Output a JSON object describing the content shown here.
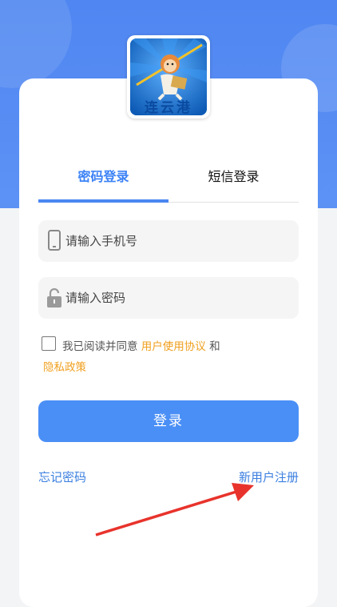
{
  "logo": {
    "text": "连云港"
  },
  "tabs": {
    "password_login": "密码登录",
    "sms_login": "短信登录",
    "active": "password_login"
  },
  "phone": {
    "placeholder": "请输入手机号",
    "value": ""
  },
  "password": {
    "placeholder": "请输入密码",
    "value": ""
  },
  "agreement": {
    "prefix": "我已阅读并同意 ",
    "user_agreement": "用户使用协议",
    "and": " 和",
    "privacy_policy": "隐私政策",
    "checked": false
  },
  "login_button": "登录",
  "forgot_password": "忘记密码",
  "register": "新用户注册",
  "colors": {
    "primary": "#4a8ff6",
    "link": "#3b7fe0",
    "accent": "#f0a020",
    "annotation": "#e8332c"
  }
}
